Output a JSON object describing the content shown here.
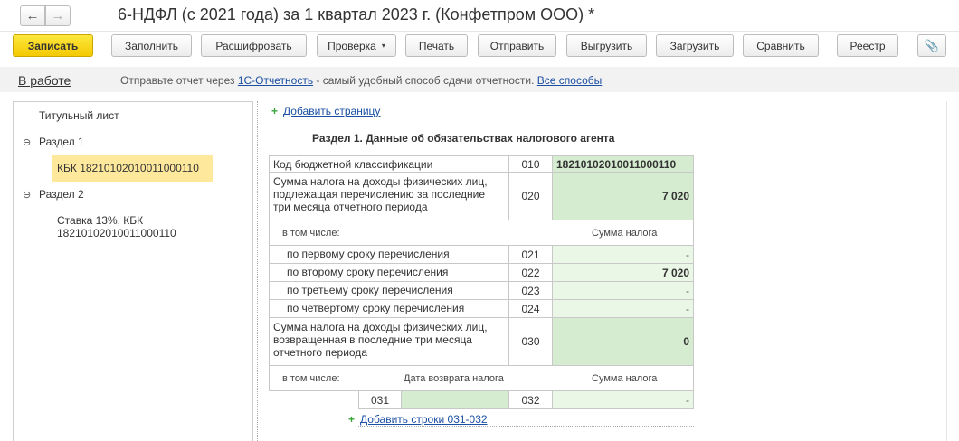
{
  "window": {
    "title": "6-НДФЛ (с 2021 года) за 1 квартал 2023 г. (Конфетпром ООО) *",
    "back_icon": "←",
    "forward_icon": "→"
  },
  "toolbar": {
    "save": "Записать",
    "fill": "Заполнить",
    "decode": "Расшифровать",
    "check": "Проверка",
    "check_caret": "▾",
    "print": "Печать",
    "send": "Отправить",
    "export": "Выгрузить",
    "import": "Загрузить",
    "compare": "Сравнить",
    "registry": "Реестр",
    "attach_icon": "📎"
  },
  "status": {
    "state": "В работе",
    "info_prefix": "Отправьте отчет через ",
    "info_link": "1С-Отчетность",
    "info_middle": " - самый удобный способ сдачи отчетности. ",
    "info_all_link": "Все способы"
  },
  "tree": {
    "title_page": "Титульный лист",
    "section1": "Раздел 1",
    "section1_kbk": "КБК 18210102010011000110",
    "section2": "Раздел 2",
    "section2_rate_line1": "Ставка 13%, КБК",
    "section2_rate_line2": "18210102010011000110",
    "toggle": "⊖"
  },
  "form": {
    "add_page": "Добавить страницу",
    "section_title": "Раздел 1. Данные об обязательствах налогового агента",
    "r010_label": "Код бюджетной классификации",
    "r010_code": "010",
    "r010_value": "18210102010011000110",
    "r020_label": "Сумма налога на доходы физических лиц, подлежащая перечислению за последние три месяца отчетного периода",
    "r020_code": "020",
    "r020_value": "7 020",
    "incl_label": "в том числе:",
    "tax_sum_header": "Сумма налога",
    "r021_label": "по первому сроку перечисления",
    "r021_code": "021",
    "r021_value": "-",
    "r022_label": "по второму сроку перечисления",
    "r022_code": "022",
    "r022_value": "7 020",
    "r023_label": "по третьему сроку перечисления",
    "r023_code": "023",
    "r023_value": "-",
    "r024_label": "по четвертому сроку перечисления",
    "r024_code": "024",
    "r024_value": "-",
    "r030_label": "Сумма налога на доходы физических лиц, возвращенная в последние три месяца отчетного периода",
    "r030_code": "030",
    "r030_value": "0",
    "incl2_label": "в том числе:",
    "return_date_header": "Дата возврата налога",
    "tax_sum_header2": "Сумма налога",
    "r031_code": "031",
    "r031_value": "",
    "r032_code": "032",
    "r032_value": "-",
    "add_rows": "Добавить строки 031-032",
    "plus": "+"
  }
}
